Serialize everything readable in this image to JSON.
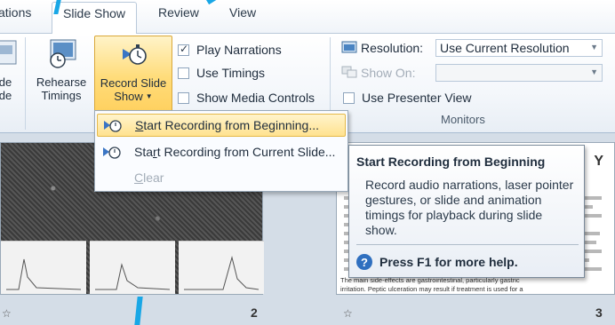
{
  "tabs": [
    {
      "label": "ations"
    },
    {
      "label": "Slide Show"
    },
    {
      "label": "Review"
    },
    {
      "label": "View"
    }
  ],
  "ribbon": {
    "partial_button_label_1": "de",
    "partial_button_label_2": "de",
    "rehearse_label_1": "Rehearse",
    "rehearse_label_2": "Timings",
    "record_label_1": "Record Slide",
    "record_label_2": "Show",
    "play_narrations": "Play Narrations",
    "use_timings": "Use Timings",
    "show_media_controls": "Show Media Controls",
    "resolution_label": "Resolution:",
    "resolution_value": "Use Current Resolution",
    "show_on_label": "Show On:",
    "use_presenter_view": "Use Presenter View",
    "monitors_group": "Monitors"
  },
  "menu": {
    "item1_u": "S",
    "item1_rest": "tart Recording from Beginning...",
    "item2_pre": "Sta",
    "item2_u": "r",
    "item2_rest": "t Recording from Current Slide...",
    "item3_u": "C",
    "item3_rest": "lear"
  },
  "tooltip": {
    "title": "Start Recording from Beginning",
    "body": "Record audio narrations, laser pointer gestures, or slide and animation timings for playback during slide show.",
    "help": "Press F1 for more help."
  },
  "slides": {
    "num2": "2",
    "num3": "3",
    "slide3_text_1": "Y",
    "slide3_text_2": "The main side-effects are gastrointestinal, particularly gastric",
    "slide3_text_3": "irritation. Peptic ulceration may result if treatment is used for a"
  },
  "colors": {
    "accent_arrow": "#19a7e6",
    "highlight": "#ffe28f"
  }
}
